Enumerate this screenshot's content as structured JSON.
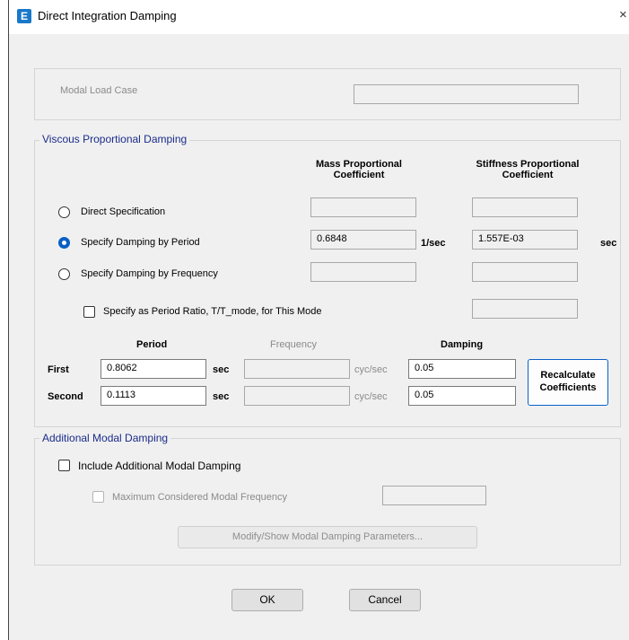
{
  "window": {
    "title": "Direct Integration Damping",
    "close": "×",
    "app_icon": "E"
  },
  "modal_load_case": {
    "label": "Modal Load Case",
    "value": ""
  },
  "viscous": {
    "legend": "Viscous Proportional Damping",
    "col_mass": "Mass Proportional\nCoefficient",
    "col_stiffness": "Stiffness Proportional\nCoefficient",
    "options": {
      "direct": "Direct Specification",
      "period": "Specify Damping by Period",
      "frequency": "Specify Damping by Frequency"
    },
    "selected": "period",
    "mass_value": "0.6848",
    "mass_unit": "1/sec",
    "stiffness_value": "1.557E-03",
    "stiffness_unit": "sec",
    "ratio_checkbox": "Specify as Period Ratio, T/T_mode, for This Mode",
    "ratio_checked": false,
    "headers": {
      "period": "Period",
      "frequency": "Frequency",
      "damping": "Damping"
    },
    "rows": [
      {
        "label": "First",
        "period": "0.8062",
        "period_unit": "sec",
        "freq": "",
        "freq_unit": "cyc/sec",
        "damping": "0.05"
      },
      {
        "label": "Second",
        "period": "0.1113",
        "period_unit": "sec",
        "freq": "",
        "freq_unit": "cyc/sec",
        "damping": "0.05"
      }
    ],
    "recalc": "Recalculate\nCoefficients"
  },
  "additional": {
    "legend": "Additional Modal Damping",
    "include_label": "Include Additional Modal Damping",
    "include_checked": false,
    "max_freq_label": "Maximum Considered Modal Frequency",
    "max_freq_value": "",
    "modify_button": "Modify/Show Modal Damping Parameters..."
  },
  "buttons": {
    "ok": "OK",
    "cancel": "Cancel"
  },
  "colors": {
    "accent": "#0a5fc6",
    "legend_text": "#1a2c8a",
    "app_icon": "#1a78c9"
  }
}
